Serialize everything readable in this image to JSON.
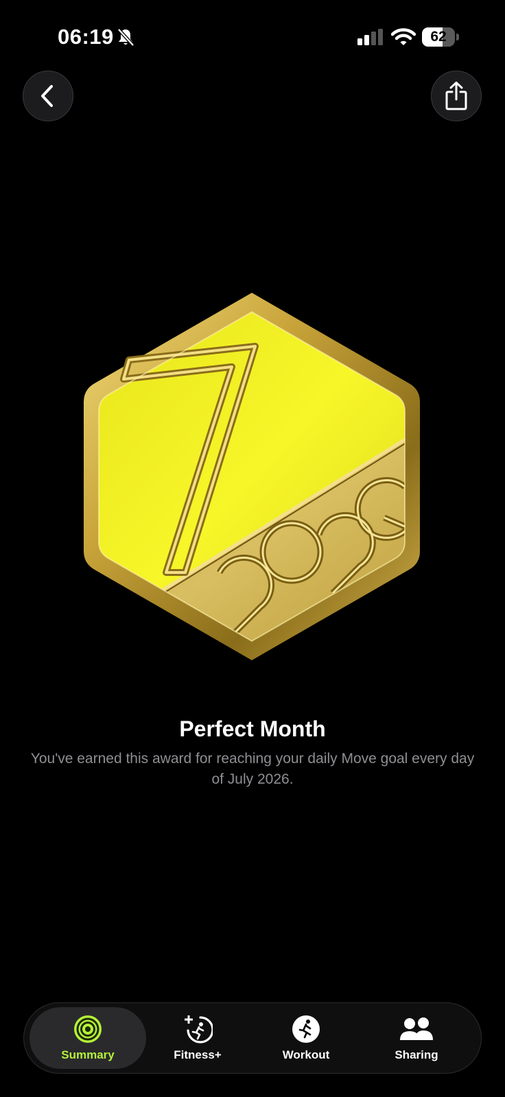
{
  "status_bar": {
    "time": "06:19",
    "battery_level": "62",
    "battery_fraction": 0.62,
    "icons": [
      "silent-bell-icon",
      "cellular-signal-icon",
      "wifi-icon",
      "battery-icon"
    ]
  },
  "header": {
    "back_icon": "chevron-left-icon",
    "share_icon": "share-icon"
  },
  "award": {
    "title": "Perfect Month",
    "description": "You've earned this award for reaching your daily Move goal every day of July 2026.",
    "colors": {
      "yellow_face": "#f4f21f",
      "gold_rim": "#c9a43a",
      "gold_dark": "#8a6d1a"
    }
  },
  "tabs": [
    {
      "label": "Summary",
      "icon": "activity-rings-icon",
      "active": true
    },
    {
      "label": "Fitness+",
      "icon": "fitness-plus-icon",
      "active": false
    },
    {
      "label": "Workout",
      "icon": "running-figure-icon",
      "active": false
    },
    {
      "label": "Sharing",
      "icon": "people-icon",
      "active": false
    }
  ],
  "colors": {
    "background": "#000000",
    "accent_green": "#b5f23a",
    "secondary_text": "#8e8e93"
  }
}
